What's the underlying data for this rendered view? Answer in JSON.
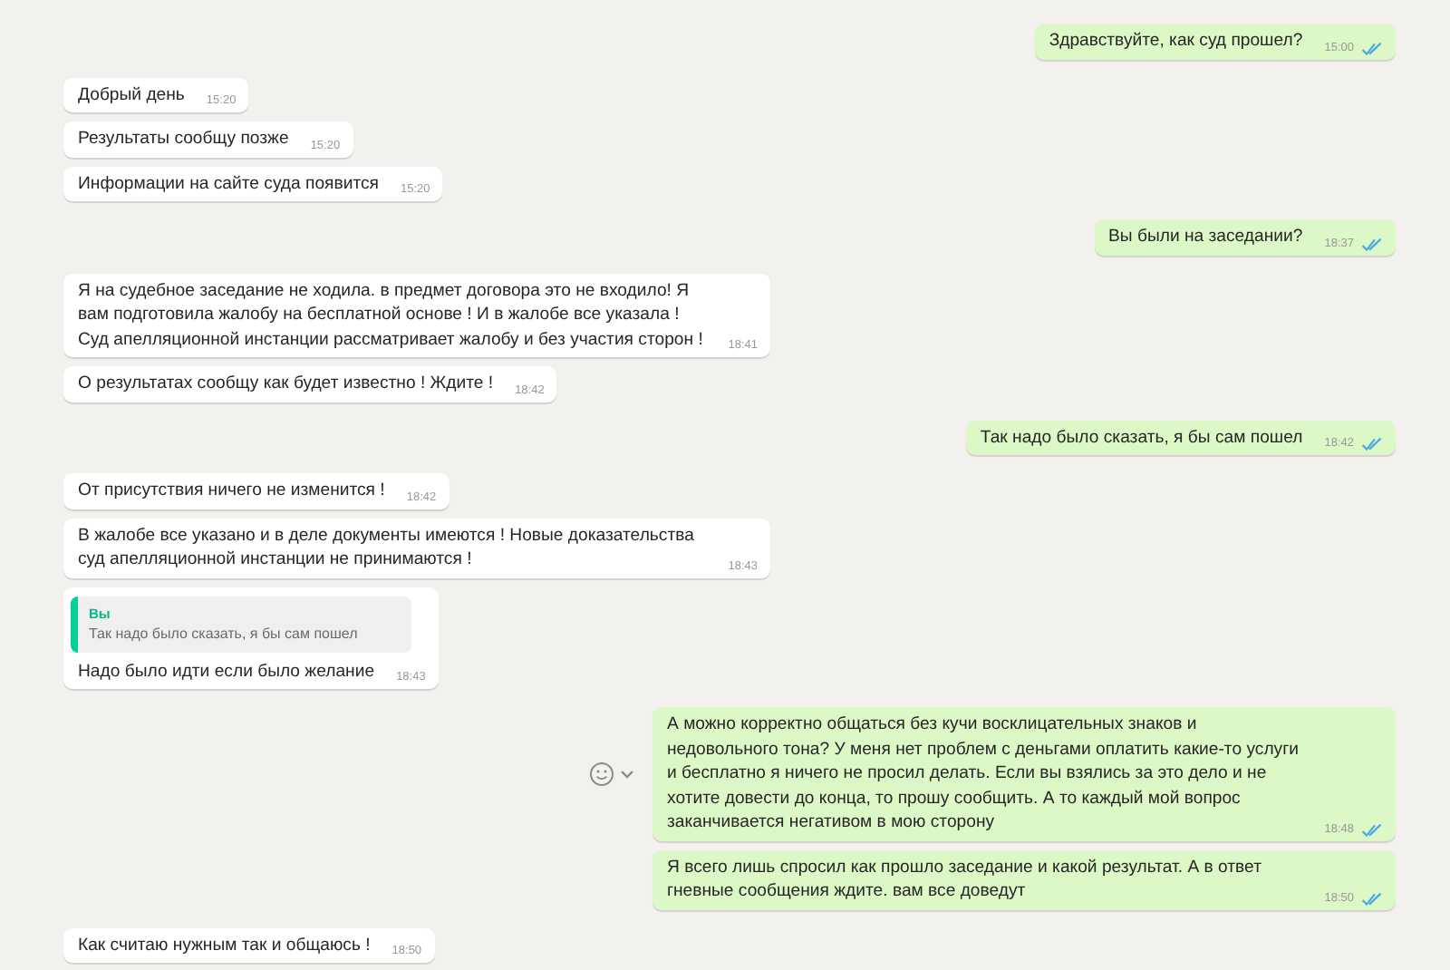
{
  "messages": [
    {
      "outgoing": true,
      "text": "Здравствуйте, как суд прошел?",
      "time": "15:00",
      "read": true
    },
    {
      "outgoing": false,
      "text": "Добрый день",
      "time": "15:20"
    },
    {
      "outgoing": false,
      "text": "Результаты сообщу позже",
      "time": "15:20"
    },
    {
      "outgoing": false,
      "text": "Информации на сайте суда появится",
      "time": "15:20"
    },
    {
      "outgoing": true,
      "text": "Вы были на заседании?",
      "time": "18:37",
      "read": true
    },
    {
      "outgoing": false,
      "text": "Я на судебное заседание не ходила. в предмет договора это не входило! Я вам подготовила жалобу на бесплатной основе ! И в жалобе все указала ! Суд апелляционной инстанции рассматривает жалобу и без участия сторон !",
      "time": "18:41"
    },
    {
      "outgoing": false,
      "text": "О результатах сообщу как будет известно ! Ждите !",
      "time": "18:42"
    },
    {
      "outgoing": true,
      "text": "Так надо было сказать, я бы сам пошел",
      "time": "18:42",
      "read": true
    },
    {
      "outgoing": false,
      "text": "От присутствия ничего не изменится !",
      "time": "18:42"
    },
    {
      "outgoing": false,
      "text": "В жалобе все указано и в деле документы имеются ! Новые доказательства суд апелляционной инстанции не принимаются !",
      "time": "18:43"
    },
    {
      "outgoing": false,
      "quote": {
        "author": "Вы",
        "text": "Так надо было сказать, я бы сам пошел"
      },
      "text": "Надо было идти если было желание",
      "time": "18:43"
    },
    {
      "outgoing": true,
      "reaction_button": true,
      "text": "А можно корректно общаться без кучи восклицательных знаков и недовольного тона? У меня нет проблем с деньгами оплатить какие-то услуги и бесплатно я ничего не просил делать. Если вы взялись за это дело и не хотите довести до конца, то прошу сообщить. А то каждый мой вопрос заканчивается негативом в мою сторону",
      "time": "18:48",
      "read": true
    },
    {
      "outgoing": true,
      "text": "Я всего лишь спросил как прошло заседание и какой результат. А в ответ гневные сообщения ждите. вам все доведут",
      "time": "18:50",
      "read": true
    },
    {
      "outgoing": false,
      "text": "Как считаю нужным так и общаюсь !",
      "time": "18:50"
    }
  ]
}
